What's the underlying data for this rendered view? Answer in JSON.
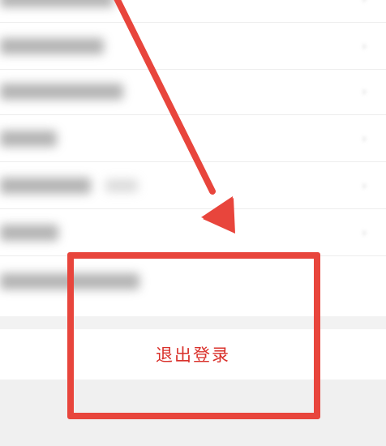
{
  "settings_rows": [
    {
      "name": "row-0"
    },
    {
      "name": "row-1"
    },
    {
      "name": "row-2"
    },
    {
      "name": "row-3"
    },
    {
      "name": "row-4"
    },
    {
      "name": "row-5"
    }
  ],
  "logout": {
    "label": "退出登录"
  },
  "colors": {
    "accent": "#e8453c",
    "logout_text": "#d9302a",
    "background": "#f2f2f2"
  },
  "icons": {
    "row_chevron": "chevron-right-icon",
    "annotation_arrow": "arrow-down-right-icon"
  }
}
